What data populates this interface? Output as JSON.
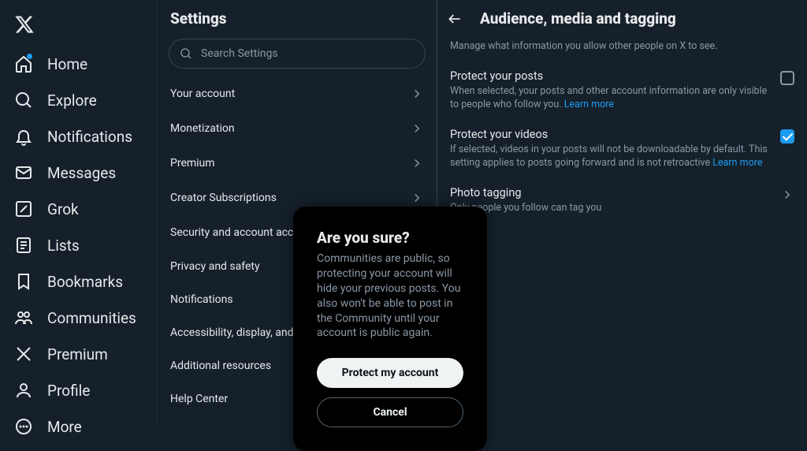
{
  "nav": {
    "items": [
      {
        "icon": "home",
        "label": "Home",
        "dot": true
      },
      {
        "icon": "search",
        "label": "Explore"
      },
      {
        "icon": "bell",
        "label": "Notifications"
      },
      {
        "icon": "mail",
        "label": "Messages"
      },
      {
        "icon": "grok",
        "label": "Grok"
      },
      {
        "icon": "list",
        "label": "Lists"
      },
      {
        "icon": "bookmark",
        "label": "Bookmarks"
      },
      {
        "icon": "communities",
        "label": "Communities"
      },
      {
        "icon": "x",
        "label": "Premium"
      },
      {
        "icon": "profile",
        "label": "Profile"
      },
      {
        "icon": "more",
        "label": "More"
      }
    ]
  },
  "settings": {
    "title": "Settings",
    "search_placeholder": "Search Settings",
    "rows": [
      "Your account",
      "Monetization",
      "Premium",
      "Creator Subscriptions",
      "Security and account access",
      "Privacy and safety",
      "Notifications",
      "Accessibility, display, and languages",
      "Additional resources",
      "Help Center"
    ]
  },
  "detail": {
    "title": "Audience, media and tagging",
    "subtitle": "Manage what information you allow other people on X to see.",
    "opt1": {
      "title": "Protect your posts",
      "desc": "When selected, your posts and other account information are only visible to people who follow you. ",
      "link": "Learn more",
      "checked": false
    },
    "opt2": {
      "title": "Protect your videos",
      "desc": "If selected, videos in your posts will not be downloadable by default. This setting applies to posts going forward and is not retroactive ",
      "link": "Learn more",
      "checked": true
    },
    "opt3": {
      "title": "Photo tagging",
      "desc": "Only people you follow can tag you"
    }
  },
  "modal": {
    "title": "Are you sure?",
    "body": "Communities are public, so protecting your account will hide your previous posts. You also won't be able to post in the Community until your account is public again.",
    "primary": "Protect my account",
    "secondary": "Cancel"
  }
}
